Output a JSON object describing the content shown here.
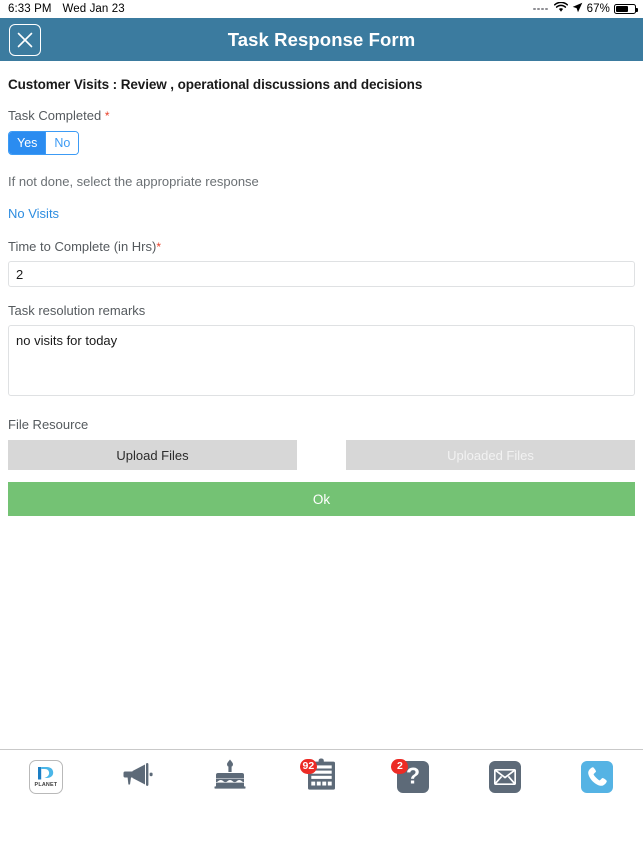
{
  "status_bar": {
    "time": "6:33 PM",
    "date": "Wed Jan 23",
    "battery_percent": "67%",
    "wifi_icon": "wifi-icon",
    "location_icon": "location-arrow-icon",
    "battery_icon": "battery-icon"
  },
  "header": {
    "title": "Task Response Form",
    "close_icon": "close-x-icon"
  },
  "form": {
    "title": "Customer Visits : Review , operational discussions and decisions",
    "task_completed": {
      "label": "Task Completed",
      "required_marker": "*",
      "options": [
        "Yes",
        "No"
      ],
      "selected": "Yes"
    },
    "hint": "If not done, select the appropriate response",
    "response_link": "No Visits",
    "time_to_complete": {
      "label": "Time to Complete (in Hrs)",
      "required_marker": "*",
      "value": "2",
      "placeholder": ""
    },
    "remarks": {
      "label": "Task resolution remarks",
      "value": "no visits for today",
      "placeholder": ""
    },
    "file_resource": {
      "label": "File Resource",
      "upload_label": "Upload Files",
      "uploaded_label": "Uploaded Files"
    },
    "submit_label": "Ok"
  },
  "colors": {
    "header_blue": "#3b7b9f",
    "accent_blue": "#2b8cf0",
    "link_blue": "#2e8de0",
    "required_red": "#e8422b",
    "submit_green": "#74c274",
    "badge_red": "#ec2b25",
    "tile_grey": "#5d6a78",
    "tile_blue": "#55b3e4",
    "file_btn_grey": "#d7d7d7"
  },
  "tabbar": {
    "items": [
      {
        "name": "planet-logo",
        "icon": "planet-logo-icon",
        "label": "PLANET",
        "badge": null
      },
      {
        "name": "announcements",
        "icon": "megaphone-icon",
        "label": "",
        "badge": null
      },
      {
        "name": "birthdays",
        "icon": "birthday-cake-icon",
        "label": "",
        "badge": null
      },
      {
        "name": "tasks",
        "icon": "clipboard-icon",
        "label": "",
        "badge": "92"
      },
      {
        "name": "help",
        "icon": "question-mark-icon",
        "label": "",
        "badge": "2"
      },
      {
        "name": "mail",
        "icon": "envelope-icon",
        "label": "",
        "badge": null
      },
      {
        "name": "call",
        "icon": "phone-icon",
        "label": "",
        "badge": null
      }
    ]
  }
}
